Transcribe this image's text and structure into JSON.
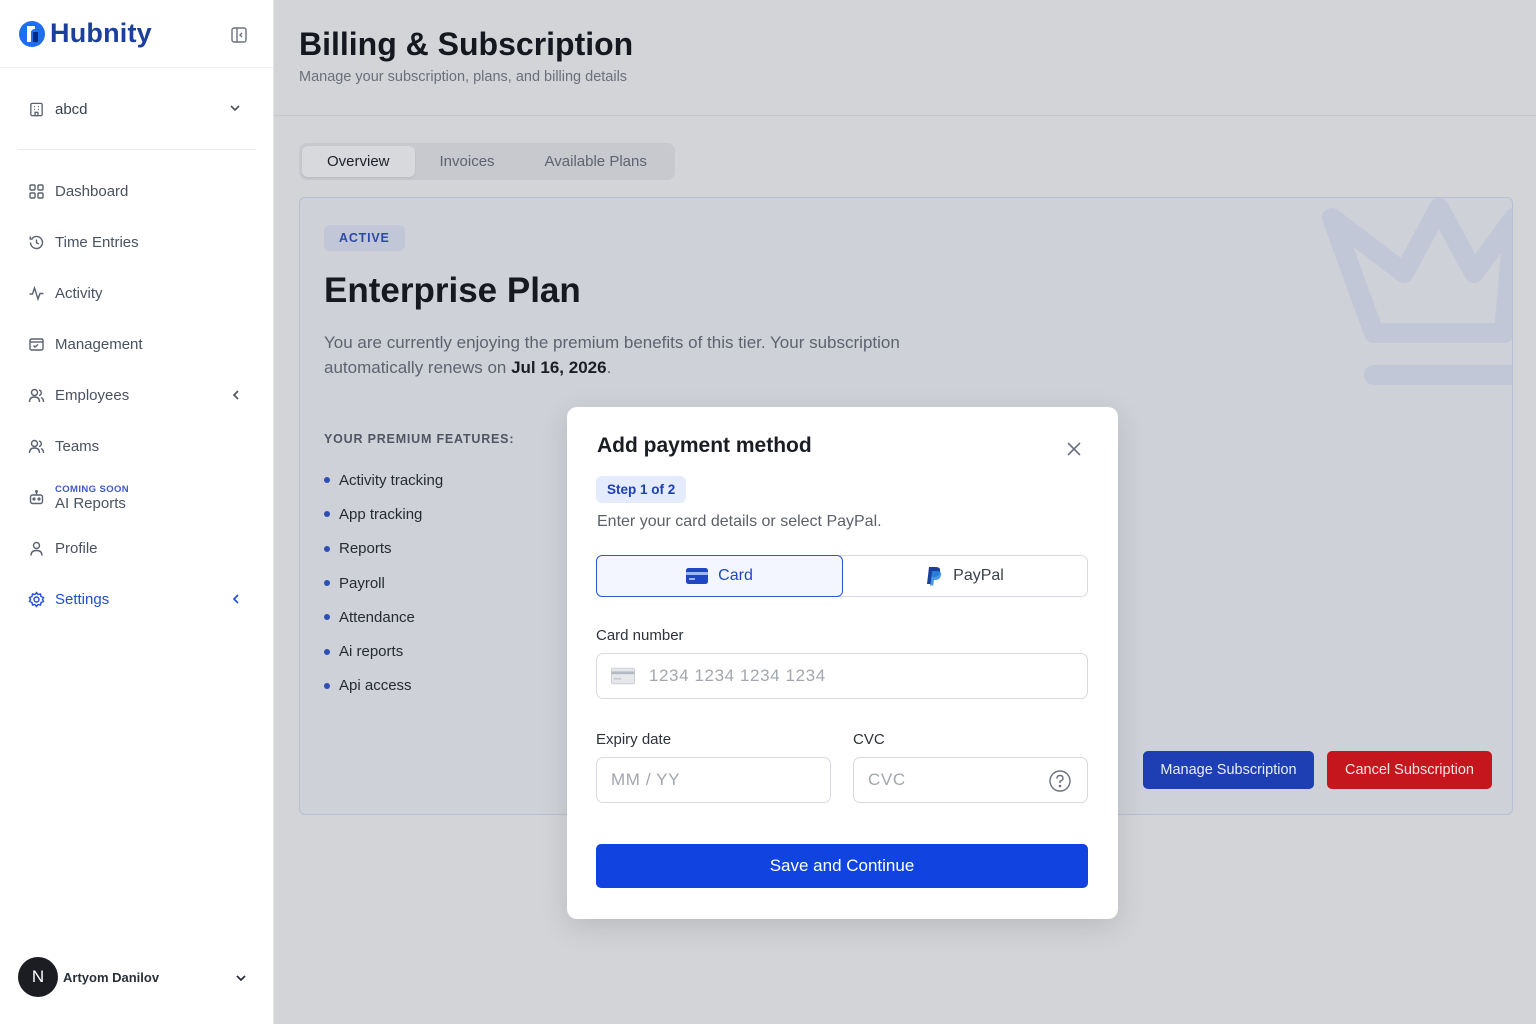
{
  "sidebar": {
    "brand": "Hubnity",
    "workspace": "abcd",
    "items": [
      {
        "label": "Dashboard"
      },
      {
        "label": "Time Entries"
      },
      {
        "label": "Activity"
      },
      {
        "label": "Management"
      },
      {
        "label": "Employees"
      },
      {
        "label": "Teams"
      },
      {
        "label": "AI Reports",
        "tag": "COMING SOON"
      },
      {
        "label": "Profile"
      },
      {
        "label": "Settings"
      }
    ],
    "user": {
      "initial": "N",
      "name": "Artyom Danilov"
    }
  },
  "header": {
    "title": "Billing & Subscription",
    "subtitle": "Manage your subscription, plans, and billing details"
  },
  "tabs": [
    "Overview",
    "Invoices",
    "Available Plans"
  ],
  "plan": {
    "status": "ACTIVE",
    "name": "Enterprise Plan",
    "description": "You are currently enjoying the premium benefits of this tier. Your subscription automatically renews on ",
    "renew_date": "Jul 16, 2026",
    "period": ".",
    "features_heading": "YOUR PREMIUM FEATURES:",
    "features": [
      "Activity tracking",
      "App tracking",
      "Reports",
      "Payroll",
      "Attendance",
      "Ai reports",
      "Api access"
    ],
    "manage_label": "Manage Subscription",
    "cancel_label": "Cancel Subscription"
  },
  "modal": {
    "title": "Add payment method",
    "step": "Step 1 of 2",
    "description": "Enter your card details or select PayPal.",
    "methods": [
      "Card",
      "PayPal"
    ],
    "card_number_label": "Card number",
    "card_number_placeholder": "1234 1234 1234 1234",
    "expiry_label": "Expiry date",
    "expiry_placeholder": "MM / YY",
    "cvc_label": "CVC",
    "cvc_placeholder": "CVC",
    "submit_label": "Save and Continue"
  },
  "colors": {
    "brand": "#1c3f9e",
    "primary": "#1143e0",
    "danger": "#c4161c",
    "active_nav": "#1d4ed8"
  }
}
